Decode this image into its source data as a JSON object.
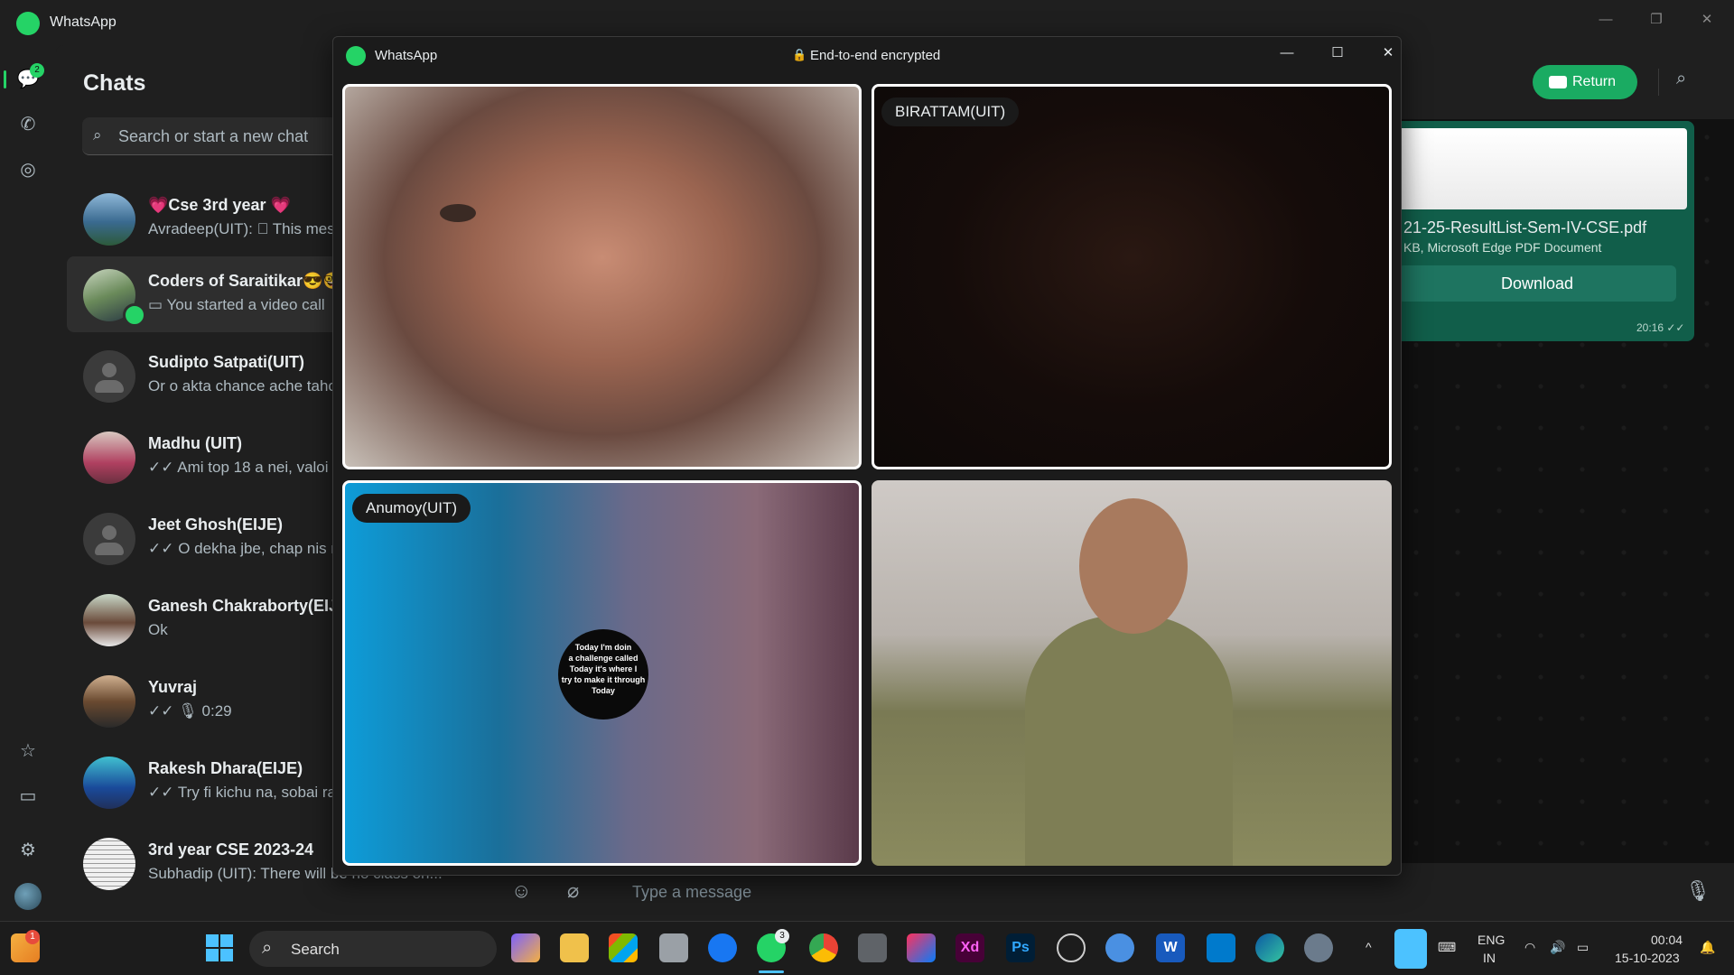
{
  "window": {
    "title": "WhatsApp",
    "minimize": "—",
    "maximize": "❐",
    "close": "✕"
  },
  "rail": {
    "chats_badge": "2"
  },
  "chats": {
    "title": "Chats",
    "search_placeholder": "Search or start a new chat",
    "items": [
      {
        "name": "💗Cse 3rd year 💗",
        "preview": "Avradeep(UIT): ⃠ This message was deleted"
      },
      {
        "name": "Coders of Saraitikar😎🤓",
        "preview": "▭ You started a video call"
      },
      {
        "name": "Sudipto Satpati(UIT)",
        "preview": "Or o akta chance ache tahole"
      },
      {
        "name": "Madhu (UIT)",
        "preview": "✓✓ Ami top 18 a nei, valoi"
      },
      {
        "name": "Jeet Ghosh(EIJE)",
        "preview": "✓✓ O dekha jbe, chap nis na"
      },
      {
        "name": "Ganesh Chakraborty(EIJE)",
        "preview": "Ok"
      },
      {
        "name": "Yuvraj",
        "preview": "✓✓ 🎙 0:29"
      },
      {
        "name": "Rakesh Dhara(EIJE)",
        "preview": "✓✓ Try fi kichu na, sobai ra"
      },
      {
        "name": "3rd year CSE 2023-24",
        "preview": "Subhadip (UIT): There will be no class on..."
      }
    ]
  },
  "conversation": {
    "return_label": "Return",
    "pdf": {
      "filename": "21-25-ResultList-Sem-IV-CSE.pdf",
      "meta": "KB, Microsoft Edge PDF Document",
      "download": "Download",
      "time": "20:16 ✓✓"
    },
    "message_placeholder": "Type a message"
  },
  "call": {
    "title": "WhatsApp",
    "encryption": "End-to-end encrypted",
    "participants": [
      {
        "name": ""
      },
      {
        "name": "BIRATTAM(UIT)"
      },
      {
        "name": "Anumoy(UIT)"
      },
      {
        "name": ""
      }
    ],
    "story_text": [
      "Today",
      "I'm doin",
      "a challenge called",
      "Today",
      "it's where I",
      "try to make it",
      "through",
      "Today"
    ]
  },
  "taskbar": {
    "search_label": "Search",
    "widgets_badge": "1",
    "whatsapp_badge": "3",
    "lang_top": "ENG",
    "lang_bottom": "IN",
    "time": "00:04",
    "date": "15-10-2023"
  }
}
